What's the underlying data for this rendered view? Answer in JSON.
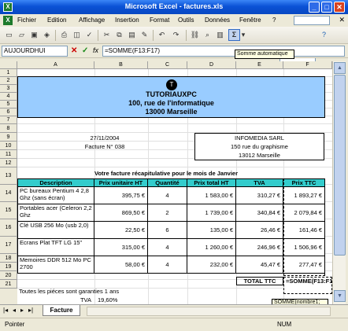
{
  "window": {
    "title": "Microsoft Excel - factures.xls",
    "logo": "X"
  },
  "menu": [
    "Fichier",
    "Edition",
    "Affichage",
    "Insertion",
    "Format",
    "Outils",
    "Données",
    "Fenêtre",
    "?"
  ],
  "toolbar": {
    "tooltip": "Somme automatique",
    "sigma": "Σ"
  },
  "formula_bar": {
    "namebox": "AUJOURDHUI",
    "fx": "fx",
    "formula": "=SOMME(F13:F17)"
  },
  "columns": [
    "A",
    "B",
    "C",
    "D",
    "E",
    "F"
  ],
  "rows": [
    "1",
    "2",
    "3",
    "4",
    "5",
    "6",
    "7",
    "8",
    "9",
    "10",
    "11",
    "12",
    "13",
    "14",
    "15",
    "16",
    "17",
    "18",
    "19",
    "20",
    "21"
  ],
  "company": {
    "name": "TUTORIAUXPC",
    "address": "100, rue de l'informatique",
    "city": "13000 Marseille",
    "logo": "T"
  },
  "invoice": {
    "date": "27/11/2004",
    "number": "Facture N° 038"
  },
  "client": {
    "name": "INFOMEDIA SARL",
    "street": "150 rue du graphisme",
    "city": "13012 Marseille"
  },
  "recap": "Votre facture récapitulative pour le mois de Janvier",
  "table": {
    "headers": [
      "Description",
      "Prix unitaire HT",
      "Quantité",
      "Prix total HT",
      "TVA",
      "Prix TTC"
    ],
    "rows": [
      [
        "PC bureaux Pentium 4 2,8 Ghz (sans écran)",
        "395,75 €",
        "4",
        "1 583,00 €",
        "310,27 €",
        "1 893,27 €"
      ],
      [
        "Portables acer (Celeron 2,2 Ghz",
        "869,50 €",
        "2",
        "1 739,00 €",
        "340,84 €",
        "2 079,84 €"
      ],
      [
        "Clé USB 256 Mo (usb 2,0)",
        "22,50 €",
        "6",
        "135,00 €",
        "26,46 €",
        "161,46 €"
      ],
      [
        "Ecrans Plat TFT    LG 15\"",
        "315,00 €",
        "4",
        "1 260,00 €",
        "246,96 €",
        "1 506,96 €"
      ],
      [
        "Memoires DDR 512 Mo PC 2700",
        "58,00 €",
        "4",
        "232,00 €",
        "45,47 €",
        "277,47 €"
      ]
    ]
  },
  "total_label": "TOTAL TTC",
  "total_formula": "=SOMME(F13:F17)",
  "formula_tip": "SOMME(nombre1;",
  "guarantee": "Toutes les piéces sont garanties 1 ans",
  "tva": {
    "label": "TVA",
    "value": "19,60%"
  },
  "sheet_tab": "Facture",
  "status": {
    "mode": "Pointer",
    "num": "NUM"
  }
}
